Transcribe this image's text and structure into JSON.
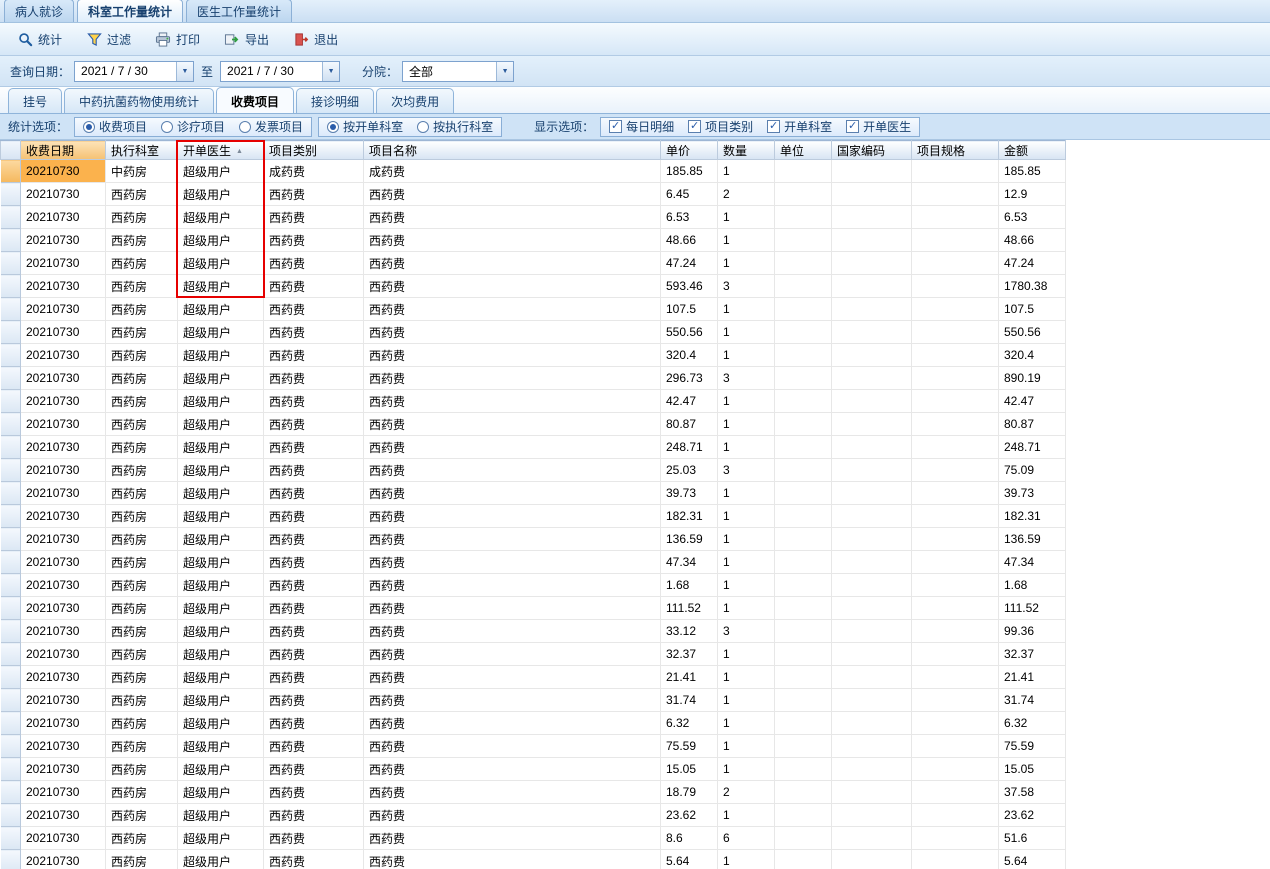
{
  "top_tabs": [
    {
      "key": "patient-visit",
      "label": "病人就诊",
      "active": false
    },
    {
      "key": "dept-workload",
      "label": "科室工作量统计",
      "active": true
    },
    {
      "key": "doctor-workload",
      "label": "医生工作量统计",
      "active": false
    }
  ],
  "toolbar": {
    "buttons": [
      {
        "key": "stats",
        "label": "统计",
        "icon": "search-icon"
      },
      {
        "key": "filter",
        "label": "过滤",
        "icon": "filter-icon"
      },
      {
        "key": "print",
        "label": "打印",
        "icon": "print-icon"
      },
      {
        "key": "export",
        "label": "导出",
        "icon": "export-icon"
      },
      {
        "key": "exit",
        "label": "退出",
        "icon": "exit-icon"
      }
    ]
  },
  "query_bar": {
    "date_label": "查询日期：",
    "date_from": "2021 / 7 / 30",
    "to_label": "至",
    "date_to": "2021 / 7 / 30",
    "branch_label": "分院：",
    "branch_value": "全部"
  },
  "report_tabs": [
    {
      "key": "registration",
      "label": "挂号",
      "active": false
    },
    {
      "key": "tcm-antibacterial-stats",
      "label": "中药抗菌药物使用统计",
      "active": false
    },
    {
      "key": "charge-items",
      "label": "收费项目",
      "active": true
    },
    {
      "key": "reception-detail",
      "label": "接诊明细",
      "active": false
    },
    {
      "key": "avg-cost",
      "label": "次均费用",
      "active": false
    }
  ],
  "options_bar": {
    "stat_label": "统计选项：",
    "stat_radios": [
      {
        "key": "charge-items",
        "label": "收费项目",
        "selected": true
      },
      {
        "key": "treatment-items",
        "label": "诊疗项目",
        "selected": false
      },
      {
        "key": "invoice-items",
        "label": "发票项目",
        "selected": false
      }
    ],
    "dept_radios": [
      {
        "key": "by-ordering-dept",
        "label": "按开单科室",
        "selected": true
      },
      {
        "key": "by-executing-dept",
        "label": "按执行科室",
        "selected": false
      }
    ],
    "display_label": "显示选项：",
    "display_checks": [
      {
        "key": "daily-detail",
        "label": "每日明细",
        "checked": true
      },
      {
        "key": "item-category",
        "label": "项目类别",
        "checked": true
      },
      {
        "key": "ordering-dept",
        "label": "开单科室",
        "checked": true
      },
      {
        "key": "ordering-doctor",
        "label": "开单医生",
        "checked": true
      }
    ]
  },
  "colors": {
    "selected_cell": "#fbb24d",
    "header_highlight": "#f5c173",
    "annotation_red": "#e60000"
  },
  "table": {
    "columns": [
      {
        "key": "charge-date",
        "label": "收费日期",
        "highlight": true
      },
      {
        "key": "exec-dept",
        "label": "执行科室"
      },
      {
        "key": "ordering-doctor",
        "label": "开单医生",
        "sort": "asc"
      },
      {
        "key": "item-category",
        "label": "项目类别"
      },
      {
        "key": "item-name",
        "label": "项目名称"
      },
      {
        "key": "unit-price",
        "label": "单价"
      },
      {
        "key": "quantity",
        "label": "数量"
      },
      {
        "key": "unit",
        "label": "单位"
      },
      {
        "key": "national-code",
        "label": "国家编码"
      },
      {
        "key": "item-spec",
        "label": "项目规格"
      },
      {
        "key": "amount",
        "label": "金额"
      }
    ],
    "selected_row_index": 0,
    "rows": [
      [
        "20210730",
        "中药房",
        "超级用户",
        "成药费",
        "成药费",
        "185.85",
        "1",
        "",
        "",
        "",
        "185.85"
      ],
      [
        "20210730",
        "西药房",
        "超级用户",
        "西药费",
        "西药费",
        "6.45",
        "2",
        "",
        "",
        "",
        "12.9"
      ],
      [
        "20210730",
        "西药房",
        "超级用户",
        "西药费",
        "西药费",
        "6.53",
        "1",
        "",
        "",
        "",
        "6.53"
      ],
      [
        "20210730",
        "西药房",
        "超级用户",
        "西药费",
        "西药费",
        "48.66",
        "1",
        "",
        "",
        "",
        "48.66"
      ],
      [
        "20210730",
        "西药房",
        "超级用户",
        "西药费",
        "西药费",
        "47.24",
        "1",
        "",
        "",
        "",
        "47.24"
      ],
      [
        "20210730",
        "西药房",
        "超级用户",
        "西药费",
        "西药费",
        "593.46",
        "3",
        "",
        "",
        "",
        "1780.38"
      ],
      [
        "20210730",
        "西药房",
        "超级用户",
        "西药费",
        "西药费",
        "107.5",
        "1",
        "",
        "",
        "",
        "107.5"
      ],
      [
        "20210730",
        "西药房",
        "超级用户",
        "西药费",
        "西药费",
        "550.56",
        "1",
        "",
        "",
        "",
        "550.56"
      ],
      [
        "20210730",
        "西药房",
        "超级用户",
        "西药费",
        "西药费",
        "320.4",
        "1",
        "",
        "",
        "",
        "320.4"
      ],
      [
        "20210730",
        "西药房",
        "超级用户",
        "西药费",
        "西药费",
        "296.73",
        "3",
        "",
        "",
        "",
        "890.19"
      ],
      [
        "20210730",
        "西药房",
        "超级用户",
        "西药费",
        "西药费",
        "42.47",
        "1",
        "",
        "",
        "",
        "42.47"
      ],
      [
        "20210730",
        "西药房",
        "超级用户",
        "西药费",
        "西药费",
        "80.87",
        "1",
        "",
        "",
        "",
        "80.87"
      ],
      [
        "20210730",
        "西药房",
        "超级用户",
        "西药费",
        "西药费",
        "248.71",
        "1",
        "",
        "",
        "",
        "248.71"
      ],
      [
        "20210730",
        "西药房",
        "超级用户",
        "西药费",
        "西药费",
        "25.03",
        "3",
        "",
        "",
        "",
        "75.09"
      ],
      [
        "20210730",
        "西药房",
        "超级用户",
        "西药费",
        "西药费",
        "39.73",
        "1",
        "",
        "",
        "",
        "39.73"
      ],
      [
        "20210730",
        "西药房",
        "超级用户",
        "西药费",
        "西药费",
        "182.31",
        "1",
        "",
        "",
        "",
        "182.31"
      ],
      [
        "20210730",
        "西药房",
        "超级用户",
        "西药费",
        "西药费",
        "136.59",
        "1",
        "",
        "",
        "",
        "136.59"
      ],
      [
        "20210730",
        "西药房",
        "超级用户",
        "西药费",
        "西药费",
        "47.34",
        "1",
        "",
        "",
        "",
        "47.34"
      ],
      [
        "20210730",
        "西药房",
        "超级用户",
        "西药费",
        "西药费",
        "1.68",
        "1",
        "",
        "",
        "",
        "1.68"
      ],
      [
        "20210730",
        "西药房",
        "超级用户",
        "西药费",
        "西药费",
        "111.52",
        "1",
        "",
        "",
        "",
        "111.52"
      ],
      [
        "20210730",
        "西药房",
        "超级用户",
        "西药费",
        "西药费",
        "33.12",
        "3",
        "",
        "",
        "",
        "99.36"
      ],
      [
        "20210730",
        "西药房",
        "超级用户",
        "西药费",
        "西药费",
        "32.37",
        "1",
        "",
        "",
        "",
        "32.37"
      ],
      [
        "20210730",
        "西药房",
        "超级用户",
        "西药费",
        "西药费",
        "21.41",
        "1",
        "",
        "",
        "",
        "21.41"
      ],
      [
        "20210730",
        "西药房",
        "超级用户",
        "西药费",
        "西药费",
        "31.74",
        "1",
        "",
        "",
        "",
        "31.74"
      ],
      [
        "20210730",
        "西药房",
        "超级用户",
        "西药费",
        "西药费",
        "6.32",
        "1",
        "",
        "",
        "",
        "6.32"
      ],
      [
        "20210730",
        "西药房",
        "超级用户",
        "西药费",
        "西药费",
        "75.59",
        "1",
        "",
        "",
        "",
        "75.59"
      ],
      [
        "20210730",
        "西药房",
        "超级用户",
        "西药费",
        "西药费",
        "15.05",
        "1",
        "",
        "",
        "",
        "15.05"
      ],
      [
        "20210730",
        "西药房",
        "超级用户",
        "西药费",
        "西药费",
        "18.79",
        "2",
        "",
        "",
        "",
        "37.58"
      ],
      [
        "20210730",
        "西药房",
        "超级用户",
        "西药费",
        "西药费",
        "23.62",
        "1",
        "",
        "",
        "",
        "23.62"
      ],
      [
        "20210730",
        "西药房",
        "超级用户",
        "西药费",
        "西药费",
        "8.6",
        "6",
        "",
        "",
        "",
        "51.6"
      ],
      [
        "20210730",
        "西药房",
        "超级用户",
        "西药费",
        "西药费",
        "5.64",
        "1",
        "",
        "",
        "",
        "5.64"
      ]
    ]
  }
}
